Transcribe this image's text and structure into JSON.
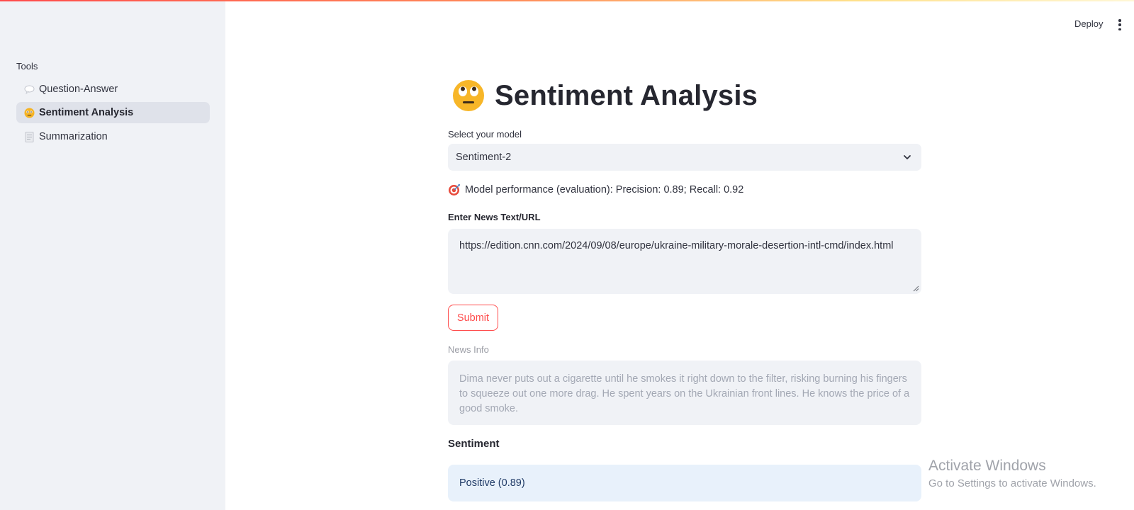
{
  "sidebar": {
    "section_title": "Tools",
    "items": [
      {
        "label": "Question-Answer",
        "icon": "speech-bubble-icon",
        "active": false
      },
      {
        "label": "Sentiment Analysis",
        "icon": "neutral-face-icon",
        "active": true
      },
      {
        "label": "Summarization",
        "icon": "document-icon",
        "active": false
      }
    ]
  },
  "header": {
    "deploy_label": "Deploy",
    "menu_icon": "vertical-ellipsis-icon"
  },
  "main": {
    "title": "Sentiment Analysis",
    "title_icon": "face-with-rolling-eyes-icon",
    "model_label": "Select your model",
    "model_selected": "Sentiment-2",
    "performance_icon": "target-icon",
    "performance_text": "Model performance (evaluation): Precision: 0.89; Recall: 0.92",
    "input_label": "Enter News Text/URL",
    "input_value": "https://edition.cnn.com/2024/09/08/europe/ukraine-military-morale-desertion-intl-cmd/index.html",
    "submit_label": "Submit",
    "news_label": "News Info",
    "news_text": "Dima never puts out a cigarette until he smokes it right down to the filter, risking burning his fingers to squeeze out one more drag. He spent years on the Ukrainian front lines. He knows the price of a good smoke.",
    "sentiment_label": "Sentiment",
    "sentiment_result": "Positive (0.89)"
  },
  "watermark": {
    "line1": "Activate Windows",
    "line2": "Go to Settings to activate Windows."
  },
  "colors": {
    "accent": "#ff4b4b",
    "sidebar_bg": "#f0f2f6",
    "active_item_bg": "#dfe2ea",
    "info_bg": "#e8f1fb"
  }
}
